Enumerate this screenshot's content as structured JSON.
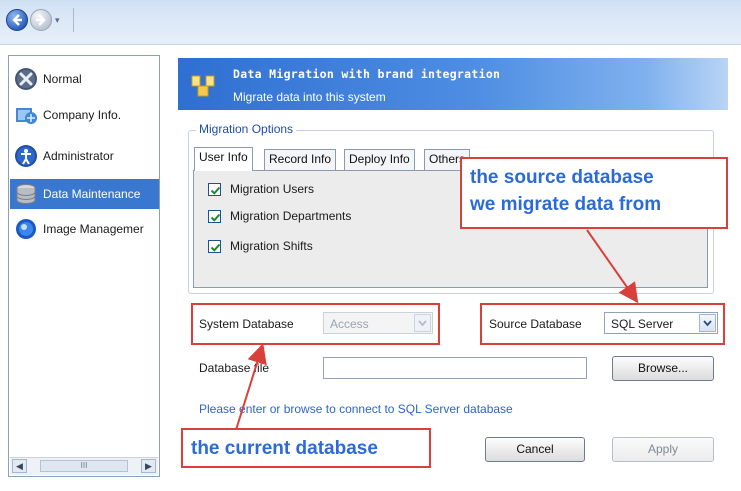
{
  "nav": {
    "back_icon": "back-arrow-icon",
    "forward_icon": "forward-arrow-icon"
  },
  "sidebar": {
    "items": [
      {
        "label": "Normal",
        "icon": "wrench-icon"
      },
      {
        "label": "Company Info.",
        "icon": "company-icon"
      },
      {
        "label": "Administrator",
        "icon": "administrator-icon"
      },
      {
        "label": "Data Maintenance",
        "icon": "database-icon",
        "active": true
      },
      {
        "label": "Image Managemer",
        "icon": "image-icon"
      }
    ],
    "scroll_thumb": "III"
  },
  "banner": {
    "title": "Data Migration with brand integration",
    "subtitle": "Migrate data into this system"
  },
  "migration_options": {
    "title": "Migration Options",
    "tabs": [
      "User Info",
      "Record Info",
      "Deploy Info",
      "Others"
    ],
    "active_tab": "User Info",
    "checkboxes": [
      {
        "label": "Migration Users",
        "checked": true
      },
      {
        "label": "Migration Departments",
        "checked": true
      },
      {
        "label": "Migration Shifts",
        "checked": true
      }
    ]
  },
  "system_database": {
    "label": "System Database",
    "value": "Access"
  },
  "source_database": {
    "label": "Source Database",
    "value": "SQL Server"
  },
  "database_file": {
    "label": "Database file",
    "value": "",
    "browse_label": "Browse..."
  },
  "hint": "Please enter or browse to connect to SQL Server database",
  "buttons": {
    "cancel": "Cancel",
    "apply": "Apply"
  },
  "annotations": {
    "source_line1": "the source database",
    "source_line2": "we migrate data from",
    "current": "the current database",
    "accent_color": "#d9403b",
    "text_color": "#2c6ad6"
  }
}
